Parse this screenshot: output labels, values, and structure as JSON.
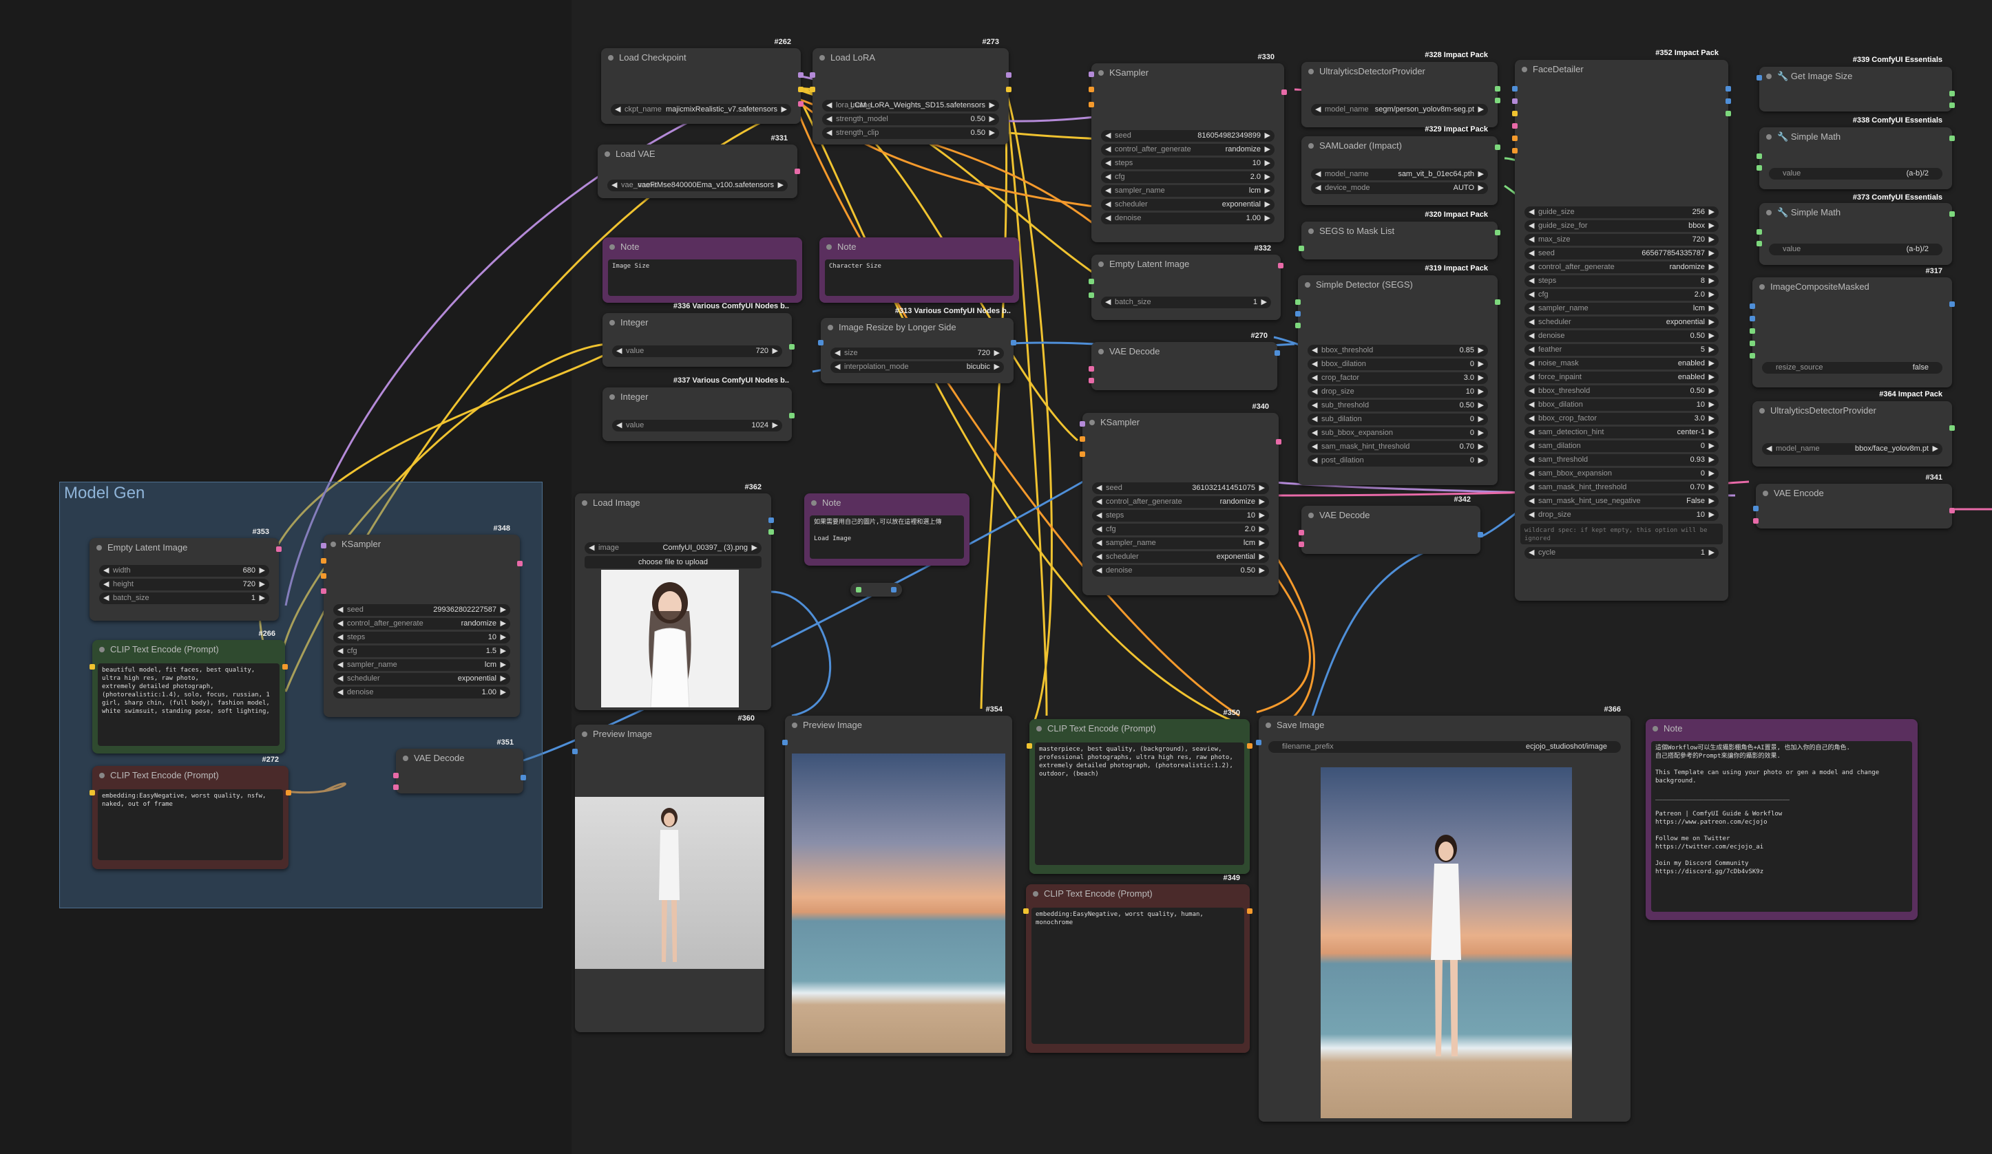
{
  "group": {
    "title": "Model Gen"
  },
  "nodes": {
    "load_checkpoint": {
      "title": "Load Checkpoint",
      "id": "#262",
      "ckpt_label": "ckpt_name",
      "ckpt_value": "majicmixRealistic_v7.safetensors"
    },
    "load_lora": {
      "title": "Load LoRA",
      "id": "#273",
      "lora_label": "lora_name",
      "lora_value": "LCM_LoRA_Weights_SD15.safetensors",
      "sm_label": "strength_model",
      "sm_value": "0.50",
      "sc_label": "strength_clip",
      "sc_value": "0.50"
    },
    "load_vae": {
      "title": "Load VAE",
      "id": "#331",
      "vae_label": "vae_name",
      "vae_value": "vaeFtMse840000Ema_v100.safetensors"
    },
    "note_image_size": {
      "title": "Note",
      "text": "Image Size"
    },
    "note_char_size": {
      "title": "Note",
      "text": "Character Size"
    },
    "integer_1": {
      "title": "Integer",
      "id": "#336 Various ComfyUI Nodes b..",
      "label": "value",
      "value": "720"
    },
    "integer_2": {
      "title": "Integer",
      "id": "#337 Various ComfyUI Nodes b..",
      "label": "value",
      "value": "1024"
    },
    "image_resize": {
      "title": "Image Resize by Longer Side",
      "id": "#313 Various ComfyUI Nodes b..",
      "size_label": "size",
      "size_value": "720",
      "interp_label": "interpolation_mode",
      "interp_value": "bicubic"
    },
    "ksampler_top": {
      "title": "KSampler",
      "id": "#330",
      "rows": [
        [
          "seed",
          "816054982349899"
        ],
        [
          "control_after_generate",
          "randomize"
        ],
        [
          "steps",
          "10"
        ],
        [
          "cfg",
          "2.0"
        ],
        [
          "sampler_name",
          "lcm"
        ],
        [
          "scheduler",
          "exponential"
        ],
        [
          "denoise",
          "1.00"
        ]
      ]
    },
    "empty_latent_right": {
      "title": "Empty Latent Image",
      "id": "#332",
      "label": "batch_size",
      "value": "1"
    },
    "vae_decode_mid": {
      "title": "VAE Decode",
      "id": "#270"
    },
    "ksampler_mid": {
      "title": "KSampler",
      "id": "#340",
      "rows": [
        [
          "seed",
          "361032141451075"
        ],
        [
          "control_after_generate",
          "randomize"
        ],
        [
          "steps",
          "10"
        ],
        [
          "cfg",
          "2.0"
        ],
        [
          "sampler_name",
          "lcm"
        ],
        [
          "scheduler",
          "exponential"
        ],
        [
          "denoise",
          "0.50"
        ]
      ]
    },
    "ultralytics_1": {
      "title": "UltralyticsDetectorProvider",
      "id": "#328 Impact Pack",
      "label": "model_name",
      "value": "segm/person_yolov8m-seg.pt"
    },
    "samloader": {
      "title": "SAMLoader (Impact)",
      "id": "#329 Impact Pack",
      "model_label": "model_name",
      "model_value": "sam_vit_b_01ec64.pth",
      "dev_label": "device_mode",
      "dev_value": "AUTO"
    },
    "segs_mask": {
      "title": "SEGS to Mask List",
      "id": "#320 Impact Pack"
    },
    "simple_detector": {
      "title": "Simple Detector (SEGS)",
      "id": "#319 Impact Pack",
      "rows": [
        [
          "bbox_threshold",
          "0.85"
        ],
        [
          "bbox_dilation",
          "0"
        ],
        [
          "crop_factor",
          "3.0"
        ],
        [
          "drop_size",
          "10"
        ],
        [
          "sub_threshold",
          "0.50"
        ],
        [
          "sub_dilation",
          "0"
        ],
        [
          "sub_bbox_expansion",
          "0"
        ],
        [
          "sam_mask_hint_threshold",
          "0.70"
        ],
        [
          "post_dilation",
          "0"
        ]
      ]
    },
    "vae_decode_right": {
      "title": "VAE Decode",
      "id": "#342"
    },
    "face_detailer": {
      "title": "FaceDetailer",
      "id": "#352 Impact Pack",
      "rows": [
        [
          "guide_size",
          "256"
        ],
        [
          "guide_size_for",
          "bbox"
        ],
        [
          "max_size",
          "720"
        ],
        [
          "seed",
          "665677854335787"
        ],
        [
          "control_after_generate",
          "randomize"
        ],
        [
          "steps",
          "8"
        ],
        [
          "cfg",
          "2.0"
        ],
        [
          "sampler_name",
          "lcm"
        ],
        [
          "scheduler",
          "exponential"
        ],
        [
          "denoise",
          "0.50"
        ],
        [
          "feather",
          "5"
        ],
        [
          "noise_mask",
          "enabled"
        ],
        [
          "force_inpaint",
          "enabled"
        ],
        [
          "bbox_threshold",
          "0.50"
        ],
        [
          "bbox_dilation",
          "10"
        ],
        [
          "bbox_crop_factor",
          "3.0"
        ],
        [
          "sam_detection_hint",
          "center-1"
        ],
        [
          "sam_dilation",
          "0"
        ],
        [
          "sam_threshold",
          "0.93"
        ],
        [
          "sam_bbox_expansion",
          "0"
        ],
        [
          "sam_mask_hint_threshold",
          "0.70"
        ],
        [
          "sam_mask_hint_use_negative",
          "False"
        ],
        [
          "drop_size",
          "10"
        ]
      ],
      "wildcard": "wildcard spec: if kept empty, this option will be ignored",
      "cycle_label": "cycle",
      "cycle_value": "1"
    },
    "get_image_size": {
      "title": "Get Image Size",
      "id": "#339 ComfyUI Essentials"
    },
    "simple_math_1": {
      "title": "Simple Math",
      "id": "#338 ComfyUI Essentials",
      "label": "value",
      "value": "(a-b)/2"
    },
    "simple_math_2": {
      "title": "Simple Math",
      "id": "#373 ComfyUI Essentials",
      "label": "value",
      "value": "(a-b)/2"
    },
    "image_composite": {
      "title": "ImageCompositeMasked",
      "id": "#317",
      "label": "resize_source",
      "value": "false"
    },
    "ultralytics_2": {
      "title": "UltralyticsDetectorProvider",
      "id": "#364 Impact Pack",
      "label": "model_name",
      "value": "bbox/face_yolov8m.pt"
    },
    "vae_encode": {
      "title": "VAE Encode",
      "id": "#341"
    },
    "empty_latent_left": {
      "title": "Empty Latent Image",
      "id": "#353",
      "rows": [
        [
          "width",
          "680"
        ],
        [
          "height",
          "720"
        ],
        [
          "batch_size",
          "1"
        ]
      ]
    },
    "ksampler_left": {
      "title": "KSampler",
      "id": "#348",
      "rows": [
        [
          "seed",
          "299362802227587"
        ],
        [
          "control_after_generate",
          "randomize"
        ],
        [
          "steps",
          "10"
        ],
        [
          "cfg",
          "1.5"
        ],
        [
          "sampler_name",
          "lcm"
        ],
        [
          "scheduler",
          "exponential"
        ],
        [
          "denoise",
          "1.00"
        ]
      ]
    },
    "clip_pos_left": {
      "title": "CLIP Text Encode (Prompt)",
      "id": "#266",
      "text": "beautiful model, fit faces, best quality, ultra high res, raw photo,\nextremely detailed photograph, (photorealistic:1.4), solo, focus, russian, 1 girl, sharp chin, (full body), fashion model, white swimsuit, standing pose, soft lighting,"
    },
    "clip_neg_left": {
      "title": "CLIP Text Encode (Prompt)",
      "id": "#272",
      "text": "embedding:EasyNegative, worst quality, nsfw, naked, out of frame"
    },
    "vae_decode_left": {
      "title": "VAE Decode",
      "id": "#351"
    },
    "load_image": {
      "title": "Load Image",
      "id": "#362",
      "img_label": "image",
      "img_value": "ComfyUI_00397_ (3).png",
      "upload": "choose file to upload"
    },
    "note_load_image": {
      "title": "Note",
      "text": "如果需要用自己的圖片,可以放在這裡和選上傳\n\nLoad Image"
    },
    "preview_left": {
      "title": "Preview Image",
      "id": "#360"
    },
    "preview_mid": {
      "title": "Preview Image",
      "id": "#354"
    },
    "clip_pos_right": {
      "title": "CLIP Text Encode (Prompt)",
      "id": "#350",
      "text": "masterpiece, best quality, (background), seaview, professional photographs, ultra high res, raw photo, extremely detailed photograph, (photorealistic:1.2), outdoor, (beach)"
    },
    "clip_neg_right": {
      "title": "CLIP Text Encode (Prompt)",
      "id": "#349",
      "text": "embedding:EasyNegative, worst quality, human, monochrome"
    },
    "save_image": {
      "title": "Save Image",
      "id": "#366",
      "label": "filename_prefix",
      "value": "ecjojo_studioshot/image"
    },
    "note_final": {
      "title": "Note",
      "text": "這個Workflow可以生成攝影棚角色+AI置景, 也加入你的自己的角色.\n自己搭配參考的Prompt來讓你的攝影的效果.\n\nThis Template can using your photo or gen a model and change background.\n\n____________________________________\n\nPatreon | ComfyUI Guide & Workflow\nhttps://www.patreon.com/ecjojo\n\nFollow me on Twitter\nhttps://twitter.com/ecjojo_ai\n\nJoin my Discord Community\nhttps://discord.gg/7cDb4vSK9z"
    }
  },
  "colors": {
    "canvas": "#1b1b1b",
    "node": "#353535",
    "group": "#46698f",
    "wire_yellow": "#f0c330",
    "wire_orange": "#f59a2c",
    "wire_blue": "#4f8fd8",
    "wire_purple": "#b48ad8",
    "wire_pink": "#e86aa8",
    "wire_green": "#7dd87d"
  }
}
